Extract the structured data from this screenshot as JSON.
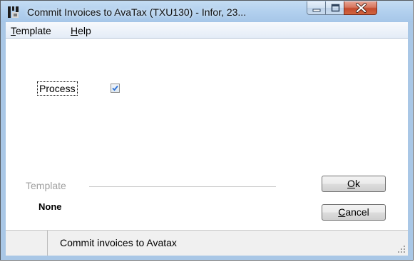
{
  "window": {
    "title": "Commit Invoices to AvaTax (TXU130) - Infor, 23..."
  },
  "menu": {
    "items": [
      {
        "accel": "T",
        "rest": "emplate"
      },
      {
        "accel": "H",
        "rest": "elp"
      }
    ]
  },
  "form": {
    "process_label": "Process",
    "process_checked": true,
    "template_label": "Template",
    "template_value": "None"
  },
  "buttons": {
    "ok": {
      "accel": "O",
      "rest": "k"
    },
    "cancel": {
      "accel": "C",
      "rest": "ancel"
    }
  },
  "status": {
    "text": "Commit invoices to Avatax"
  },
  "colors": {
    "frame": "#a9c7e6",
    "close_button": "#c44a2e",
    "checkbox_check": "#2a6fd6"
  }
}
